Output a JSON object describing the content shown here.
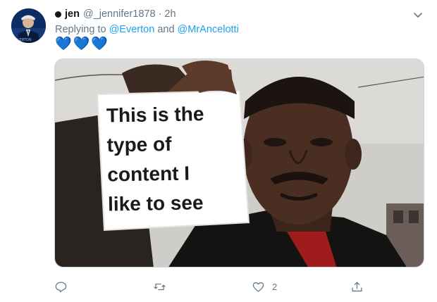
{
  "tweet": {
    "display_name": "jen",
    "handle": "@_jennifer1878",
    "separator": "·",
    "time": "2h",
    "replying_prefix": "Replying to",
    "mention_1": "@Everton",
    "and_text": "and",
    "mention_2": "@MrAncelotti",
    "emoji": [
      "💙",
      "💙",
      "💙"
    ],
    "image_text": {
      "line1": "This is the",
      "line2": "type of",
      "line3": "content I",
      "line4": "like to see"
    },
    "actions": {
      "reply_icon": "comment-icon",
      "retweet_icon": "retweet-icon",
      "like_icon": "heart-icon",
      "like_count": "2",
      "share_icon": "share-icon"
    }
  },
  "colors": {
    "link": "#1da1f2",
    "secondary_text": "#657786",
    "primary_text": "#14171a",
    "heart_emoji": "#5db0ea"
  }
}
